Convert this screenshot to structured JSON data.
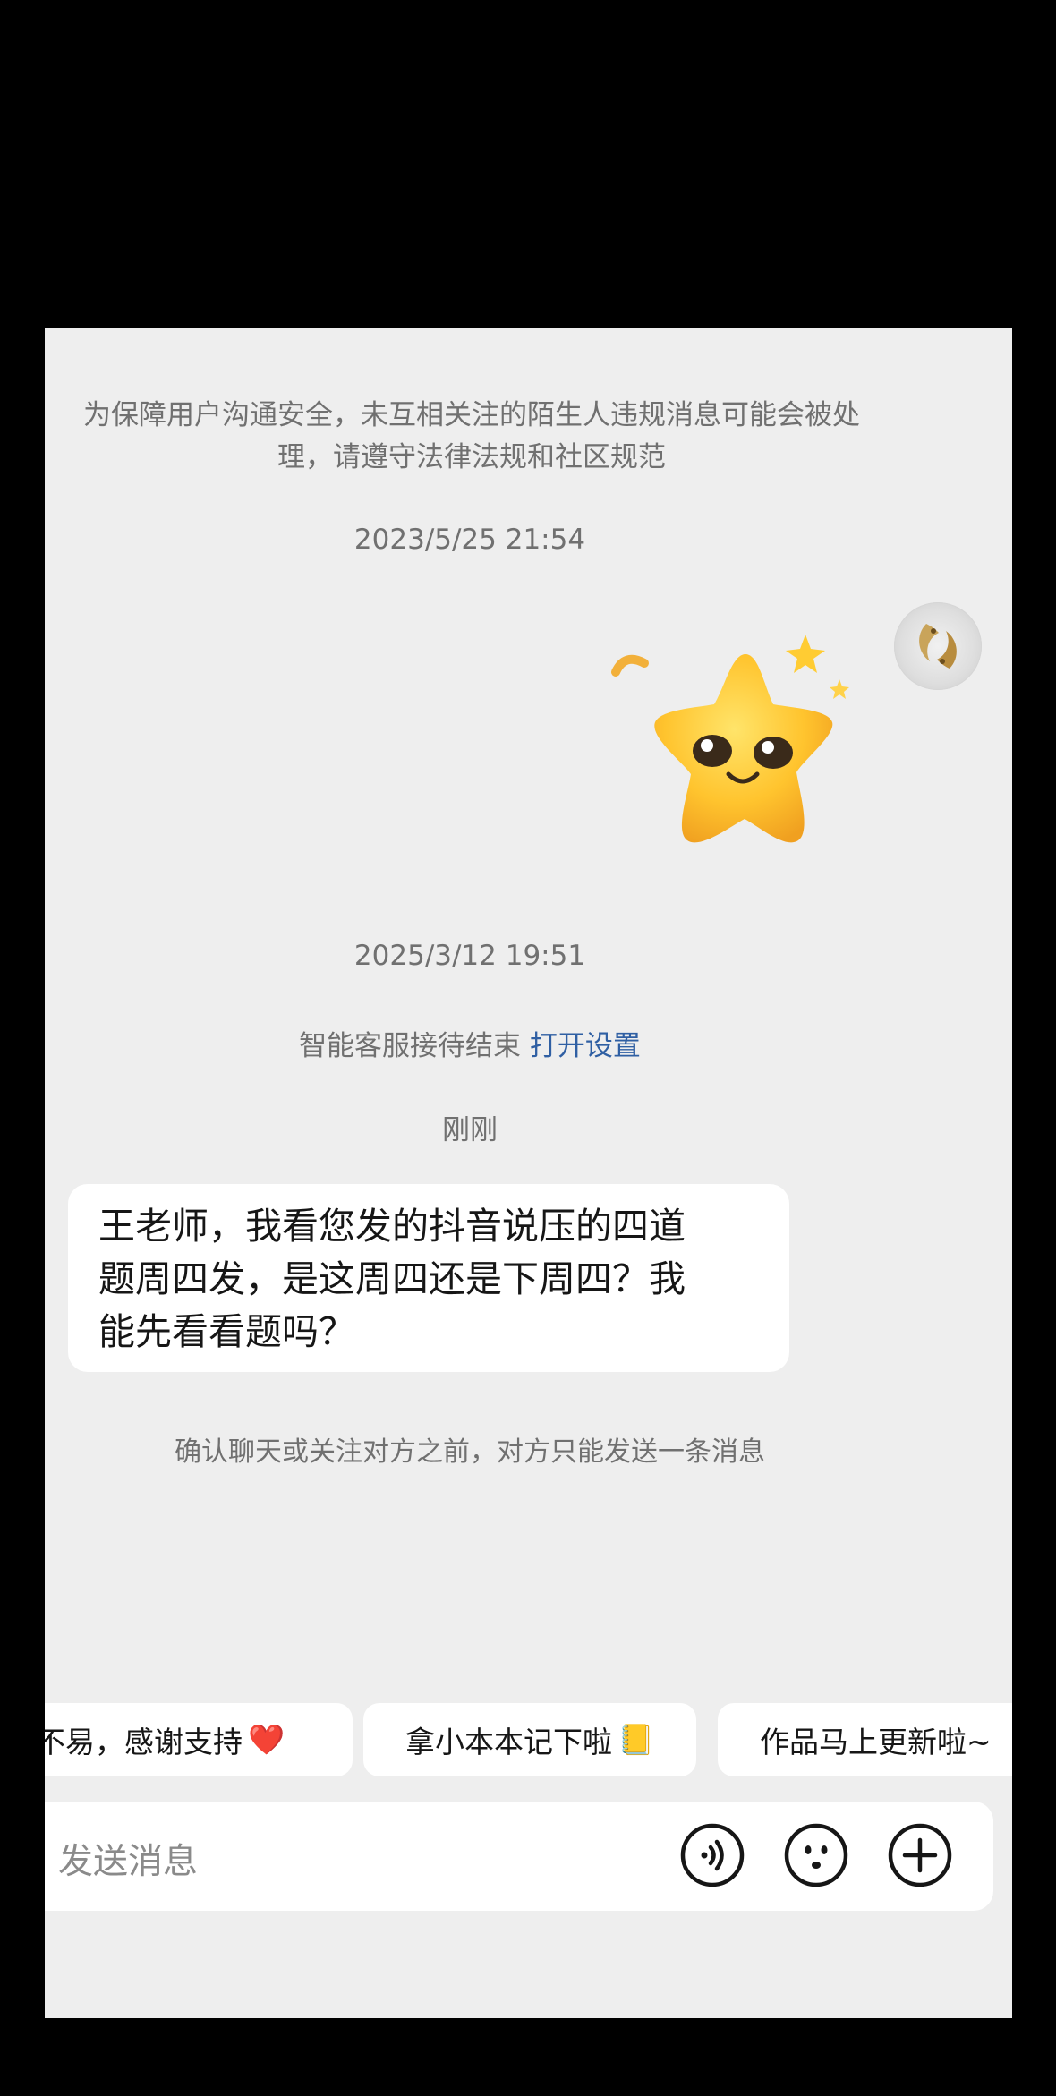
{
  "notice": {
    "line1": "为保障用户沟通安全，未互相关注的陌生人违规消息可能会被处",
    "line2": "理，请遵守法律法规和社区规范"
  },
  "timestamps": {
    "first": "2023/5/25 21:54",
    "second": "2025/3/12 19:51",
    "third": "刚刚"
  },
  "service": {
    "text": "智能客服接待结束",
    "link": "打开设置"
  },
  "message": {
    "line1": "王老师，我看您发的抖音说压的四道",
    "line2": "题周四发，是这周四还是下周四？我",
    "line3": "能先看看题吗？"
  },
  "confirm_text": "确认聊天或关注对方之前，对方只能发送一条消息",
  "quick_replies": [
    {
      "label": "不易，感谢支持",
      "emoji": "❤️"
    },
    {
      "label": "拿小本本记下啦",
      "emoji": "📒"
    },
    {
      "label": "作品马上更新啦~",
      "emoji": ""
    }
  ],
  "composer": {
    "placeholder": "发送消息",
    "voice_icon": "voice-icon",
    "emoji_icon": "emoji-icon",
    "plus_icon": "plus-icon"
  },
  "colors": {
    "background": "#eeeeee",
    "link": "#2f5fa3",
    "muted_text": "#707070"
  }
}
